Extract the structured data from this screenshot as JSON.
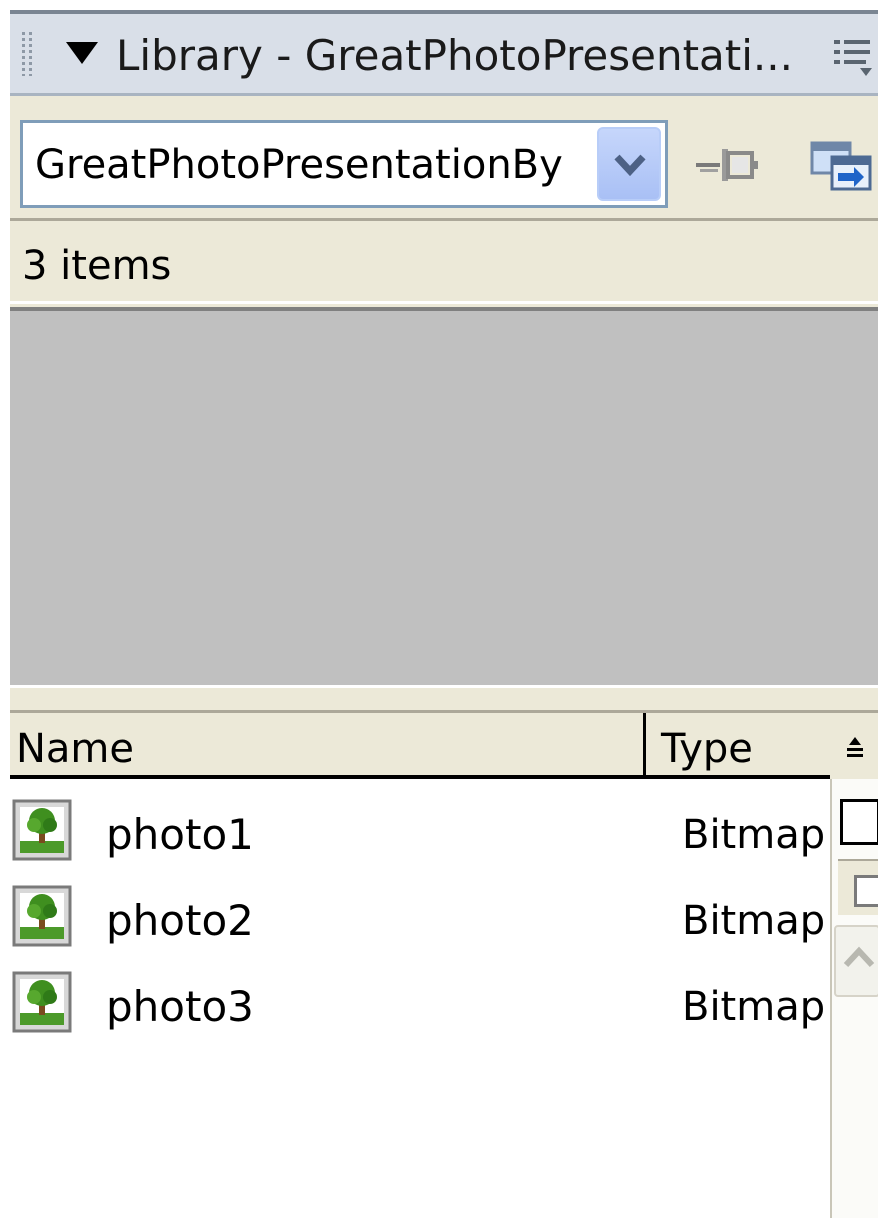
{
  "panel": {
    "title": "Library - GreatPhotoPresentati...",
    "document_select": {
      "value": "GreatPhotoPresentationBy"
    },
    "item_count": "3 items"
  },
  "columns": {
    "name": "Name",
    "type": "Type"
  },
  "items": [
    {
      "name": "photo1",
      "type": "Bitmap",
      "icon": "bitmap-icon"
    },
    {
      "name": "photo2",
      "type": "Bitmap",
      "icon": "bitmap-icon"
    },
    {
      "name": "photo3",
      "type": "Bitmap",
      "icon": "bitmap-icon"
    }
  ],
  "icons": {
    "grip": "grip-icon",
    "collapse": "collapse-triangle-icon",
    "options": "options-menu-icon",
    "pin": "pin-icon",
    "new_library": "new-library-window-icon",
    "sort": "sort-order-icon"
  },
  "colors": {
    "panel_bg": "#ece9d8",
    "titlebar_bg": "#d9dfe8",
    "preview_bg": "#c0c0c0",
    "combo_border": "#7f9db9",
    "combo_button": "#a9c0f5"
  }
}
